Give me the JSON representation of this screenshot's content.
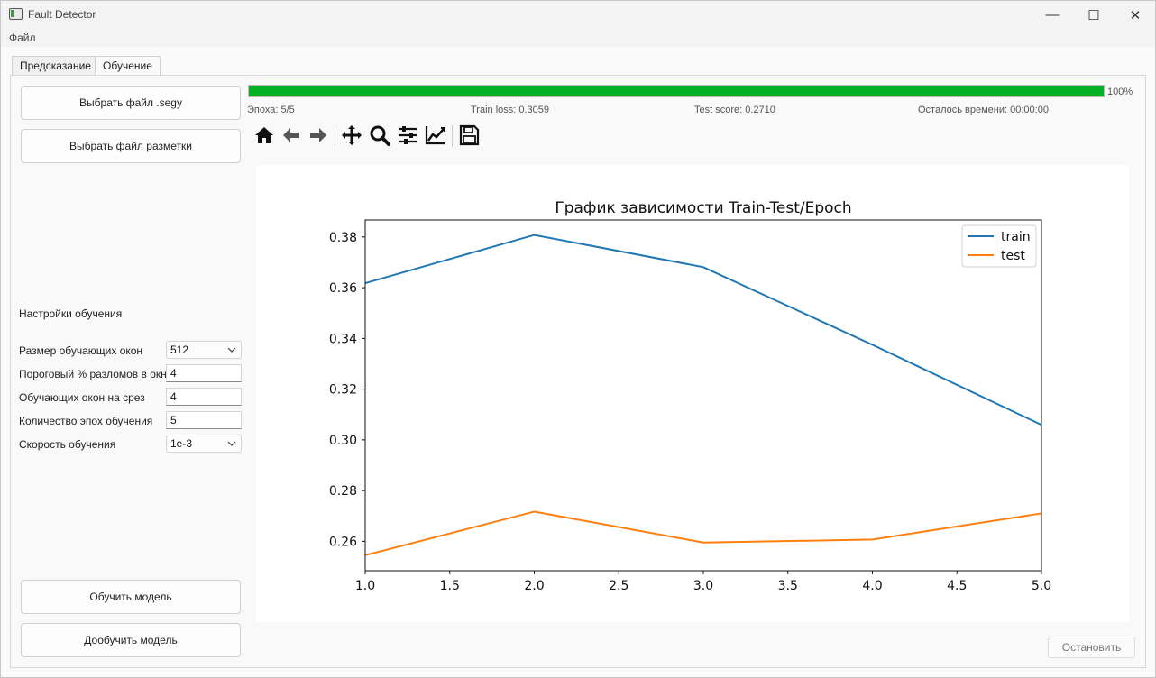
{
  "window": {
    "title": "Fault Detector",
    "controls": {
      "minimize": "—",
      "maximize": "☐",
      "close": "✕"
    }
  },
  "menu": {
    "file": "Файл"
  },
  "tabs": [
    {
      "label": "Предсказание",
      "active": false
    },
    {
      "label": "Обучение",
      "active": true
    }
  ],
  "left_panel": {
    "select_segy": "Выбрать файл .segy",
    "select_markup": "Выбрать файл разметки",
    "settings_title": "Настройки обучения",
    "settings": {
      "window_size": {
        "label": "Размер обучающих окон",
        "value": "512"
      },
      "fault_threshold": {
        "label": "Пороговый % разломов в окне",
        "value": "4"
      },
      "windows_per_slice": {
        "label": "Обучающих окон на срез",
        "value": "4"
      },
      "epochs": {
        "label": "Количество эпох обучения",
        "value": "5"
      },
      "learning_rate": {
        "label": "Скорость обучения",
        "value": "1e-3"
      }
    },
    "train_button": "Обучить модель",
    "finetune_button": "Дообучить модель"
  },
  "progress": {
    "value": 1.0,
    "percent_text": "100%",
    "epoch": "Эпоха: 5/5",
    "train_loss": "Train loss: 0.3059",
    "test_score": "Test score: 0.2710",
    "time_left": "Осталось времени: 00:00:00",
    "color": "#06b025"
  },
  "toolbar": {
    "icons": [
      "home-icon",
      "back-arrow-icon",
      "forward-arrow-icon",
      "pan-icon",
      "zoom-icon",
      "configure-subplots-icon",
      "edit-axis-icon",
      "save-icon"
    ]
  },
  "stop_button": "Остановить",
  "chart_data": {
    "type": "line",
    "title": "График зависимости Train-Test/Epoch",
    "xlabel": "",
    "ylabel": "",
    "x": [
      1,
      2,
      3,
      4,
      5
    ],
    "series": [
      {
        "name": "train",
        "values": [
          0.3618,
          0.3808,
          0.3681,
          0.3375,
          0.3059
        ],
        "color": "#1f77b4"
      },
      {
        "name": "test",
        "values": [
          0.2545,
          0.2717,
          0.2595,
          0.2607,
          0.271
        ],
        "color": "#ff7f0e"
      }
    ],
    "xlim": [
      1.0,
      5.0
    ],
    "ylim": [
      0.2484,
      0.3867
    ],
    "xticks": [
      "1.0",
      "1.5",
      "2.0",
      "2.5",
      "3.0",
      "3.5",
      "4.0",
      "4.5",
      "5.0"
    ],
    "yticks": [
      "0.26",
      "0.28",
      "0.30",
      "0.32",
      "0.34",
      "0.36",
      "0.38"
    ],
    "grid": false,
    "legend": "top-right"
  }
}
